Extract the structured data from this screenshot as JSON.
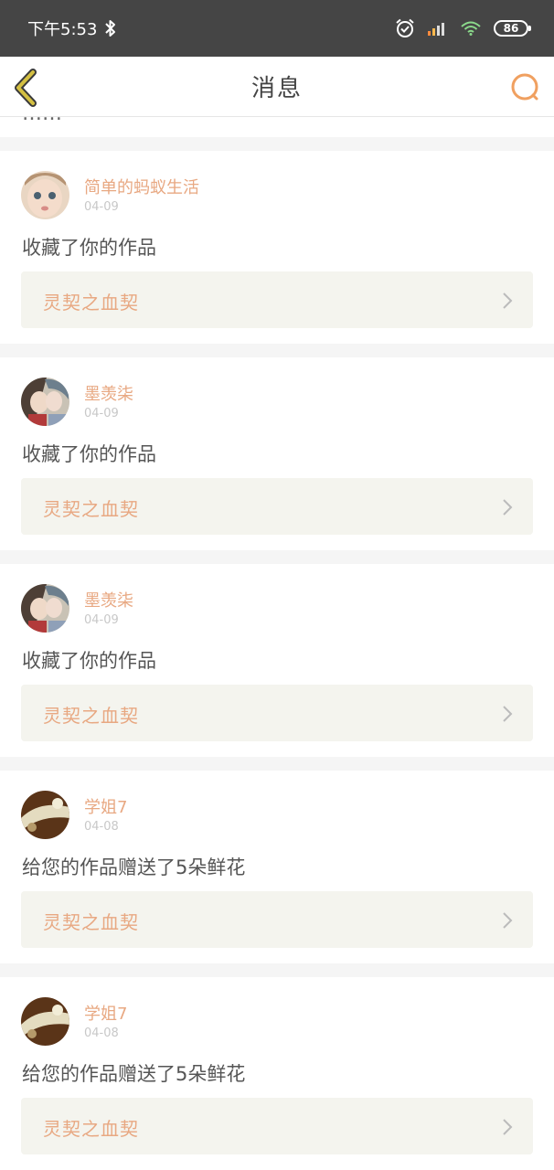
{
  "status_bar": {
    "time": "下午5:53",
    "battery": "86",
    "icons": [
      "bluetooth-icon",
      "alarm-icon",
      "signal-icon",
      "wifi-icon",
      "battery-icon"
    ]
  },
  "header": {
    "title": "消息",
    "back_icon": "chevron-left-icon",
    "search_icon": "search-icon"
  },
  "colors": {
    "accent": "#e8a882",
    "back_icon": "#d4c042",
    "search_icon": "#f0a060",
    "status_bar": "#454545",
    "work_box": "#f4f4ee",
    "divider": "#f5f5f5"
  },
  "messages": [
    {
      "username": "简单的蚂蚁生活",
      "date": "04-09",
      "text": "收藏了你的作品",
      "work_title": "灵契之血契"
    },
    {
      "username": "墨羡柒",
      "date": "04-09",
      "text": "收藏了你的作品",
      "work_title": "灵契之血契"
    },
    {
      "username": "墨羡柒",
      "date": "04-09",
      "text": "收藏了你的作品",
      "work_title": "灵契之血契"
    },
    {
      "username": "学姐7",
      "date": "04-08",
      "text": "给您的作品赠送了5朵鲜花",
      "work_title": "灵契之血契"
    },
    {
      "username": "学姐7",
      "date": "04-08",
      "text": "给您的作品赠送了5朵鲜花",
      "work_title": "灵契之血契"
    }
  ]
}
